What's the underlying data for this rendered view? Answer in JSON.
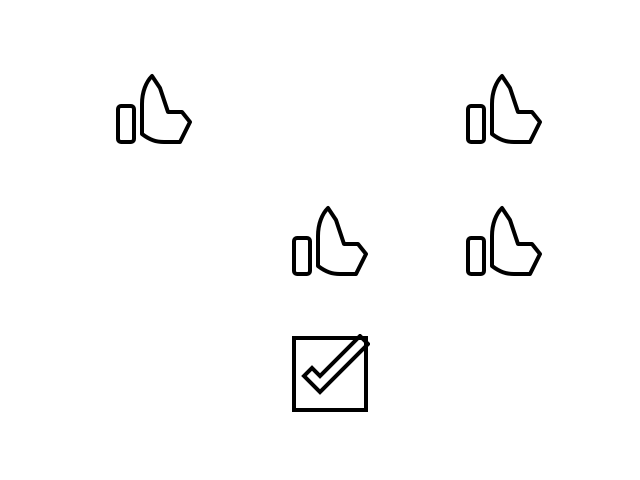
{
  "icons": [
    {
      "name": "thumbs-up-icon",
      "color": "#000000"
    },
    {
      "name": "thumbs-up-icon",
      "color": "#000000"
    },
    {
      "name": "thumbs-up-icon",
      "color": "#000000"
    },
    {
      "name": "thumbs-up-icon",
      "color": "#000000"
    },
    {
      "name": "checkbox-checked-icon",
      "color": "#000000"
    }
  ],
  "background_color": "#ffffff"
}
